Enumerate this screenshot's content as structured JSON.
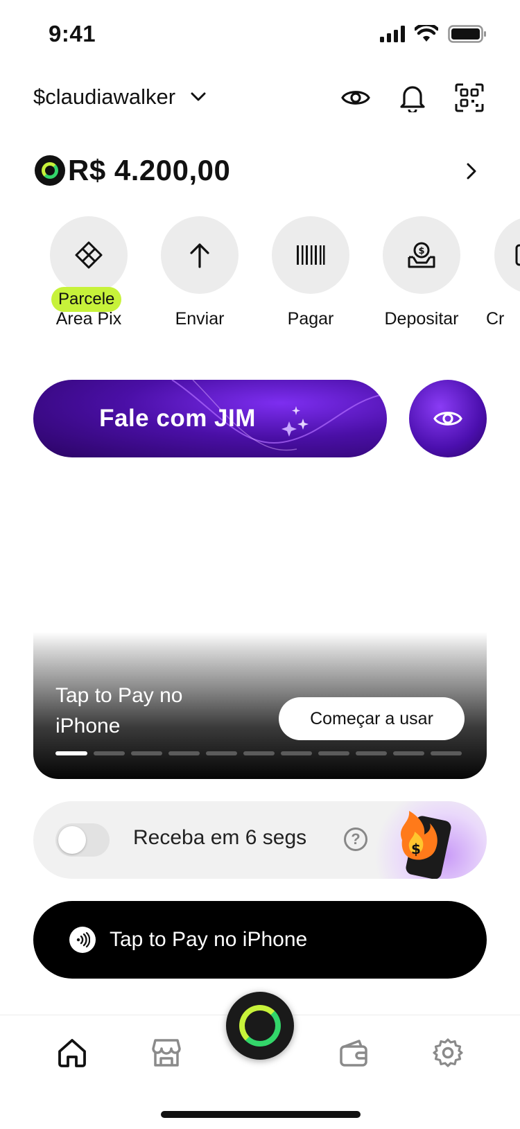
{
  "status_bar": {
    "time": "9:41"
  },
  "header": {
    "handle": "$claudiawalker"
  },
  "balance": {
    "amount": "R$ 4.200,00"
  },
  "quick_actions": [
    {
      "label": "Área Pix",
      "badge": "Parcele",
      "icon": "pix-icon"
    },
    {
      "label": "Enviar",
      "icon": "arrow-up-icon"
    },
    {
      "label": "Pagar",
      "icon": "barcode-icon"
    },
    {
      "label": "Depositar",
      "icon": "deposit-icon"
    },
    {
      "label": "Cr",
      "icon": "card-icon"
    }
  ],
  "jim": {
    "label": "Fale com JIM"
  },
  "tap_card": {
    "title": "Tap to Pay no iPhone",
    "cta": "Começar a usar",
    "slides_total": 11,
    "slide_active": 1
  },
  "receive": {
    "label": "Receba em 6 segs",
    "toggle_on": false,
    "help": "?"
  },
  "tap_button": {
    "label": "Tap to Pay no iPhone"
  },
  "bottom_nav": [
    "home-icon",
    "store-icon",
    "jim-ring-icon",
    "wallet-icon",
    "settings-icon"
  ],
  "colors": {
    "accent_green": "#c7f23a",
    "brand_purple": "#4a0fa6",
    "text": "#111111"
  }
}
